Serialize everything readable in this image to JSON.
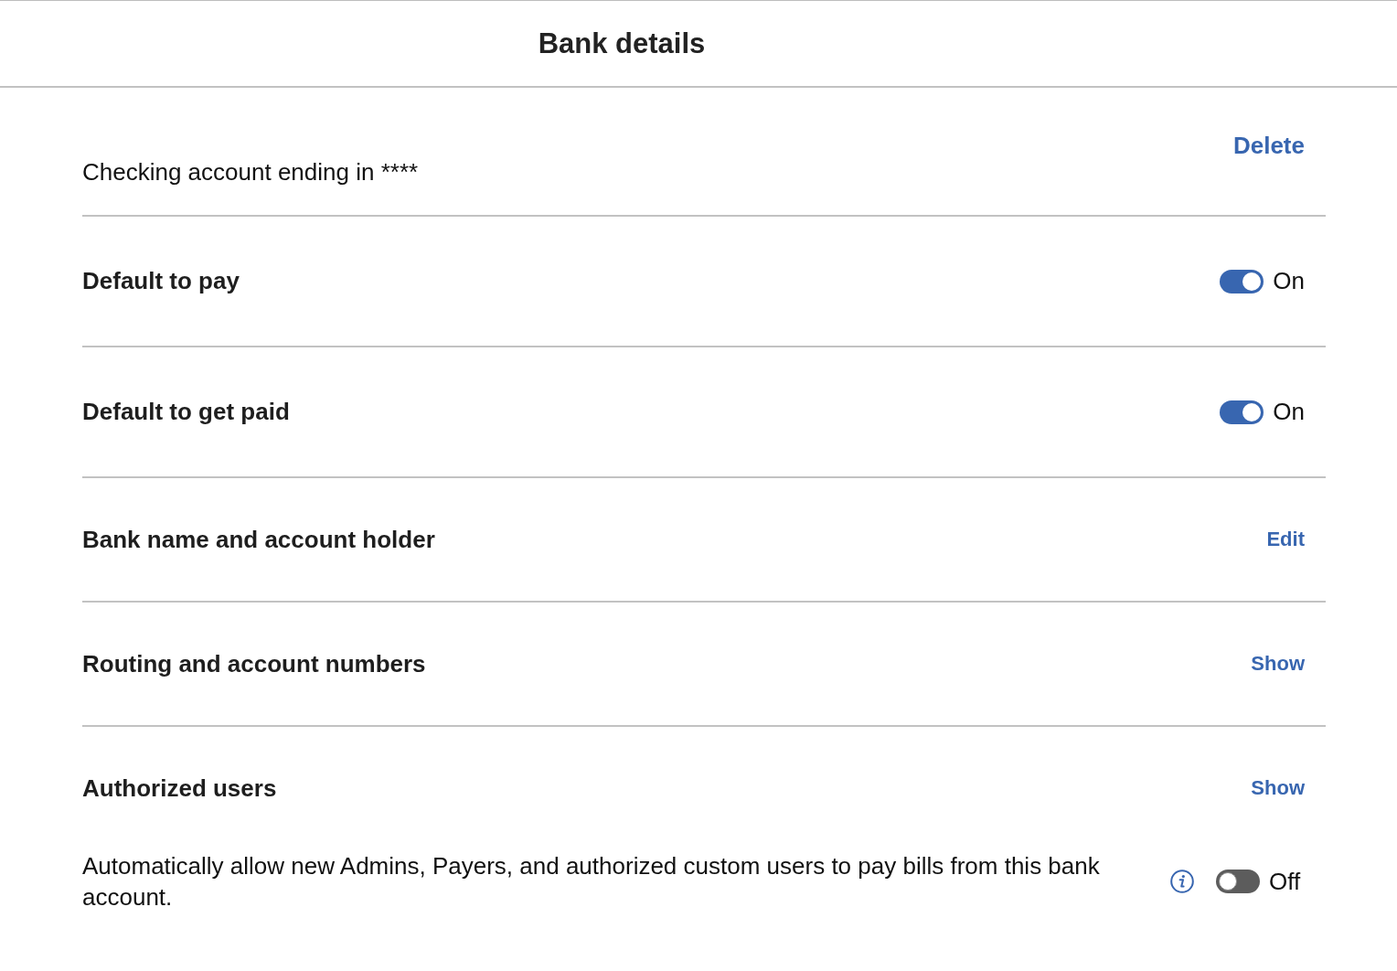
{
  "header": {
    "title": "Bank details"
  },
  "account": {
    "label": "Checking account ending in ****",
    "action": "Delete"
  },
  "rows": [
    {
      "kind": "toggle",
      "label": "Default to pay",
      "on": true,
      "state_label": "On"
    },
    {
      "kind": "toggle",
      "label": "Default to get paid",
      "on": true,
      "state_label": "On"
    },
    {
      "kind": "link",
      "label": "Bank name and account holder",
      "action": "Edit"
    },
    {
      "kind": "link",
      "label": "Routing and account numbers",
      "action": "Show"
    }
  ],
  "authorized_users": {
    "label": "Authorized users",
    "action": "Show",
    "auto_allow": {
      "text": "Automatically allow new Admins, Payers, and authorized custom users to pay bills from this bank account.",
      "on": false,
      "state_label": "Off"
    }
  }
}
